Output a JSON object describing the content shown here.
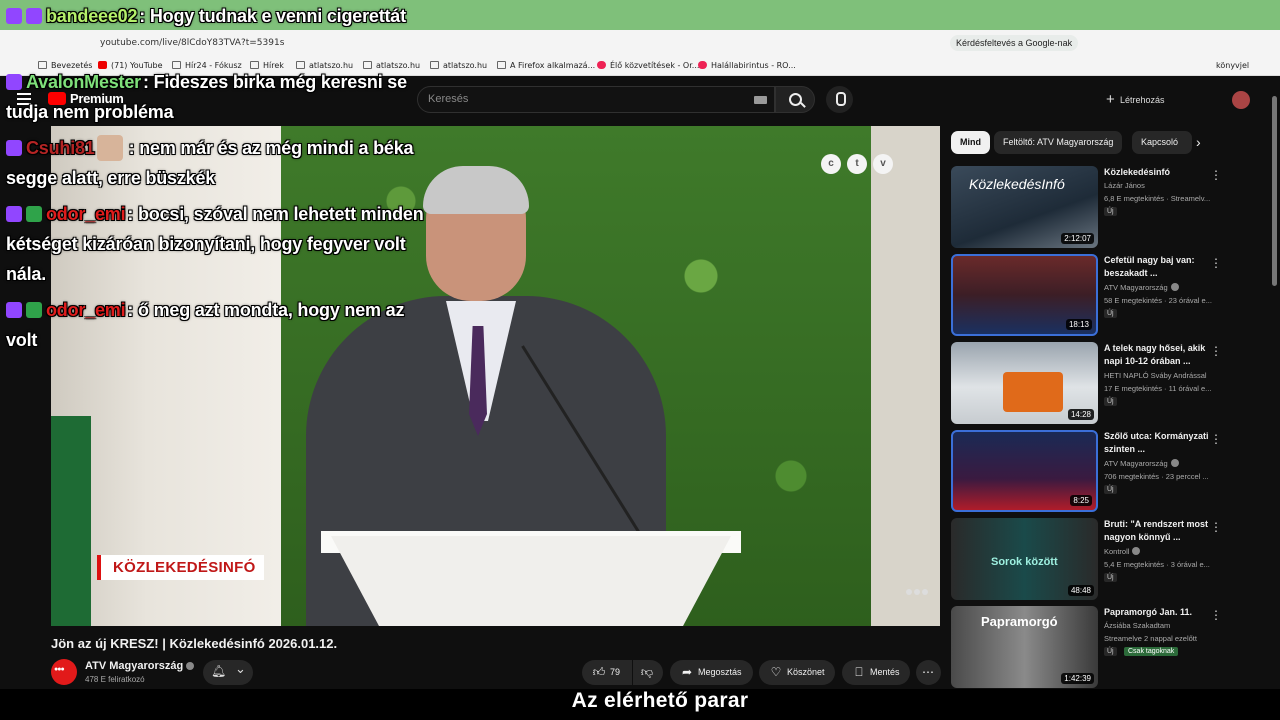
{
  "browser": {
    "url": "youtube.com/live/8lCdoY83TVA?t=5391s",
    "google_chip": "Kérdésfeltevés a Google-nak",
    "bookmarks": [
      "Bevezetés",
      "(71) YouTube",
      "Hír24 - Fókusz",
      "Hírek",
      "atlatszo.hu",
      "atlatszo.hu",
      "atlatszo.hu",
      "A Firefox alkalmazá...",
      "Élő közvetítések - Or...",
      "Halállabirintus - RO..."
    ],
    "side_label": "könyvjel"
  },
  "header": {
    "premium_label": "Premium",
    "search_placeholder": "Keresés",
    "create_label": "Létrehozás"
  },
  "video": {
    "lower_third": "KÖZLEKEDÉSINFÓ",
    "bug_letters": [
      "c",
      "t",
      "v"
    ],
    "title": "Jön az új KRESZ! | Közlekedésinfó 2026.01.12.",
    "channel": "ATV Magyarország",
    "subscribers": "478 E feliratkozó",
    "likes": "79",
    "share": "Megosztás",
    "thanks": "Köszönet",
    "save": "Mentés",
    "subtitle": "Az elérhető parar"
  },
  "chips": [
    "Mind",
    "Feltöltő: ATV Magyarország",
    "Kapcsoló"
  ],
  "recommendations": [
    {
      "title": "Közlekedésinfó",
      "channel": "Lázár János",
      "meta": "6,8 E megtekintés · Streamelv...",
      "badge": "Új",
      "duration": "2:12:07",
      "thumb_text": "KözlekedésInfó"
    },
    {
      "title": "Cefetül nagy baj van: beszakadt ...",
      "channel": "ATV Magyarország",
      "meta": "58 E megtekintés · 23 órával e...",
      "badge": "Új",
      "duration": "18:13",
      "thumb_text": ""
    },
    {
      "title": "A telek nagy hősei, akik napi 10-12 órában ...",
      "channel": "HETI NAPLÓ Sváby Andrással",
      "meta": "17 E megtekintés · 11 órával e...",
      "badge": "Új",
      "duration": "14:28",
      "thumb_text": ""
    },
    {
      "title": "Szőlő utca: Kormányzati szinten ...",
      "channel": "ATV Magyarország",
      "meta": "706 megtekintés · 23 perccel ...",
      "badge": "Új",
      "duration": "8:25",
      "thumb_text": ""
    },
    {
      "title": "Bruti: \"A rendszert most nagyon könnyű ...",
      "channel": "Kontroll",
      "meta": "5,4 E megtekintés · 3 órával e...",
      "badge": "Új",
      "duration": "48:48",
      "thumb_text": "Sorok között"
    },
    {
      "title": "Papramorgó Jan. 11.",
      "channel": "Ázsiába Szakadtam",
      "meta": "Streamelve 2 nappal ezelőtt",
      "badge": "Új",
      "badge2": "Csak tagoknak",
      "duration": "1:42:39",
      "thumb_text": "Papramorgó"
    }
  ],
  "chat": [
    {
      "user": "bandeee02",
      "user_color": "#b4f06a",
      "text": ": Hogy tudnak e venni cigerettát"
    },
    {
      "user": "AvalonMester",
      "user_color": "#7ee07a",
      "text": ": Fideszes birka még keresni se tudja nem probléma"
    },
    {
      "user": "Csuhi81",
      "user_color": "#b52424",
      "text": ": nem már és az még mindi a béka segge alatt, erre büszkék"
    },
    {
      "user": "odor_emi",
      "user_color": "#e01c1c",
      "text": ": bocsi, szóval nem lehetett minden kétséget kizáróan bizonyítani, hogy fegyver volt nála."
    },
    {
      "user": "odor_emi",
      "user_color": "#e01c1c",
      "text": ": ő meg azt mondta, hogy nem az volt"
    }
  ],
  "colors": {
    "accent": "#ff0000",
    "background": "#0f0f0f",
    "lower_third_red": "#c01818"
  }
}
